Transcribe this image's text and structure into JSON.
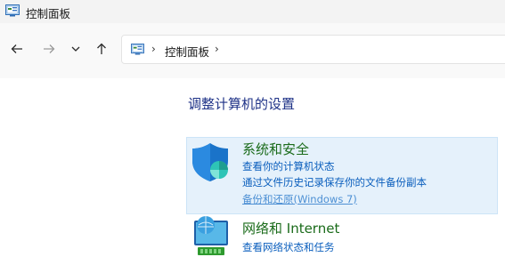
{
  "window": {
    "title": "控制面板"
  },
  "address": {
    "crumb": "控制面板",
    "separator": "›"
  },
  "main": {
    "heading": "调整计算机的设置",
    "categories": [
      {
        "title": "系统和安全",
        "links": [
          "查看你的计算机状态",
          "通过文件历史记录保存你的文件备份副本",
          "备份和还原(Windows 7)"
        ]
      },
      {
        "title": "网络和 Internet",
        "links": [
          "查看网络状态和任务"
        ]
      }
    ]
  },
  "colors": {
    "hover_bg": "#e5f1fb",
    "link": "#0a5ebd",
    "category_title": "#1a6b1a",
    "heading": "#1e3287"
  }
}
